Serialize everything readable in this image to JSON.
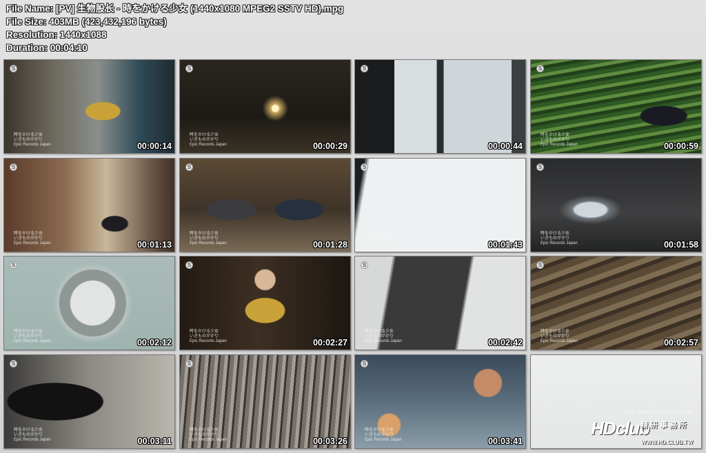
{
  "file_info": {
    "file_name": "File Name: [PV] 生物股长 - 時をかける少女 (1440x1080 MPEG2 SSTV HD).mpg",
    "file_size": "File Size: 403MB (423,432,196 bytes)",
    "resolution": "Resolution: 1440x1088",
    "duration": "Duration: 00:04:10"
  },
  "thumbnails": [
    {
      "timestamp": "00:00:14",
      "scene": "room-woman-yellow",
      "credit": "時をかける少女\nいきものがかり\nEpic Records Japan"
    },
    {
      "timestamp": "00:00:29",
      "scene": "dark-projector",
      "credit": "時をかける少女\nいきものがかり\nEpic Records Japan"
    },
    {
      "timestamp": "00:00:44",
      "scene": "window-peek",
      "credit": ""
    },
    {
      "timestamp": "00:00:59",
      "scene": "running-girl-green",
      "credit": "時をかける少女\nいきものがかり\nEpic Records Japan"
    },
    {
      "timestamp": "00:01:13",
      "scene": "room-girl-seated",
      "credit": "時をかける少女\nいきものがかり\nEpic Records Japan"
    },
    {
      "timestamp": "00:01:28",
      "scene": "dinner-table",
      "credit": "時をかける少女\nいきものがかり\nEpic Records Japan"
    },
    {
      "timestamp": "00:01:43",
      "scene": "email-screen",
      "credit": "時をかける少女\nいきものがかり\nEpic Records Japan"
    },
    {
      "timestamp": "00:01:58",
      "scene": "glass-cylinder",
      "credit": "時をかける少女\nいきものがかり\nEpic Records Japan"
    },
    {
      "timestamp": "00:02:12",
      "scene": "coin-jar",
      "credit": "時をかける少女\nいきものがかり\nEpic Records Japan"
    },
    {
      "timestamp": "00:02:27",
      "scene": "woman-clapping",
      "credit": "時をかける少女\nいきものがかり\nEpic Records Japan"
    },
    {
      "timestamp": "00:02:42",
      "scene": "baby-photo",
      "credit": "時をかける少女\nいきものがかり\nEpic Records Japan"
    },
    {
      "timestamp": "00:02:57",
      "scene": "giant-numbers",
      "credit": "時をかける少女\nいきものがかり\nEpic Records Japan"
    },
    {
      "timestamp": "00:03:11",
      "scene": "silhouette",
      "credit": "時をかける少女\nいきものがかり\nEpic Records Japan"
    },
    {
      "timestamp": "00:03:26",
      "scene": "park-trees",
      "credit": "時をかける少女\nいきものがかり\nEpic Records Japan"
    },
    {
      "timestamp": "00:03:41",
      "scene": "toys-kids",
      "credit": "時をかける少女\nいきものがかり\nEpic Records Japan"
    },
    {
      "timestamp": "",
      "scene": "blank-white",
      "credit": ""
    }
  ],
  "watermark": {
    "tagline": "High Definition Vision Club",
    "brand": "HDclub",
    "brand_cjk": "精研事務所",
    "url": "WWW.HD.CLUB.TW"
  }
}
